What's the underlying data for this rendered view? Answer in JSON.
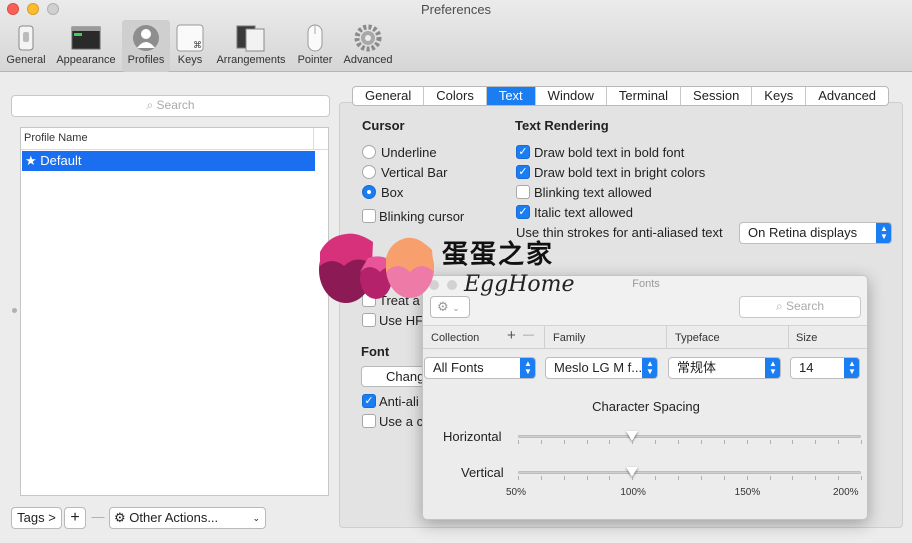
{
  "window": {
    "title": "Preferences"
  },
  "toolbar": {
    "items": [
      {
        "label": "General",
        "icon": "switch-icon"
      },
      {
        "label": "Appearance",
        "icon": "window-icon"
      },
      {
        "label": "Profiles",
        "icon": "person-icon"
      },
      {
        "label": "Keys",
        "icon": "command-key-icon"
      },
      {
        "label": "Arrangements",
        "icon": "arrangement-icon"
      },
      {
        "label": "Pointer",
        "icon": "mouse-icon"
      },
      {
        "label": "Advanced",
        "icon": "gear-icon"
      }
    ],
    "selected": "Profiles"
  },
  "left": {
    "search_placeholder": "Search",
    "column_header": "Profile Name",
    "profiles": [
      {
        "name": "★ Default",
        "selected": true
      }
    ],
    "tags_button": "Tags >",
    "add_symbol": "+",
    "remove_symbol": "—",
    "other_actions": "Other Actions..."
  },
  "tabs": [
    "General",
    "Colors",
    "Text",
    "Window",
    "Terminal",
    "Session",
    "Keys",
    "Advanced"
  ],
  "active_tab": "Text",
  "cursor": {
    "heading": "Cursor",
    "options": [
      "Underline",
      "Vertical Bar",
      "Box"
    ],
    "selected": "Box",
    "blinking_label": "Blinking cursor"
  },
  "text_rendering": {
    "heading": "Text Rendering",
    "options": [
      {
        "label": "Draw bold text in bold font",
        "checked": true
      },
      {
        "label": "Draw bold text in bright colors",
        "checked": true
      },
      {
        "label": "Blinking text allowed",
        "checked": false
      },
      {
        "label": "Italic text allowed",
        "checked": true
      }
    ],
    "thin_strokes_label": "Use thin strokes for anti-aliased text",
    "thin_strokes_value": "On Retina displays"
  },
  "partial": {
    "treat_label": "Treat a",
    "use_hf_label": "Use HF",
    "font_heading": "Font",
    "change_button": "Chang",
    "anti_label": "Anti-ali",
    "use_a_label": "Use a c"
  },
  "fonts_panel": {
    "title": "Fonts",
    "search_placeholder": "Search",
    "add_symbol": "+",
    "remove_symbol": "—",
    "columns": [
      "Collection",
      "Family",
      "Typeface",
      "Size"
    ],
    "collection": "All Fonts",
    "family": "Meslo LG M f...",
    "typeface": "常规体",
    "size": "14",
    "spacing_title": "Character Spacing",
    "horizontal_label": "Horizontal",
    "vertical_label": "Vertical",
    "horizontal_value_percent": 100,
    "vertical_value_percent": 100,
    "scale_labels": [
      "50%",
      "100%",
      "150%",
      "200%"
    ]
  },
  "watermark": {
    "text_cn": "蛋蛋之家",
    "text_en": "EggHome"
  },
  "colors": {
    "accent": "#1a7df2",
    "selection": "#1a6ff0"
  }
}
